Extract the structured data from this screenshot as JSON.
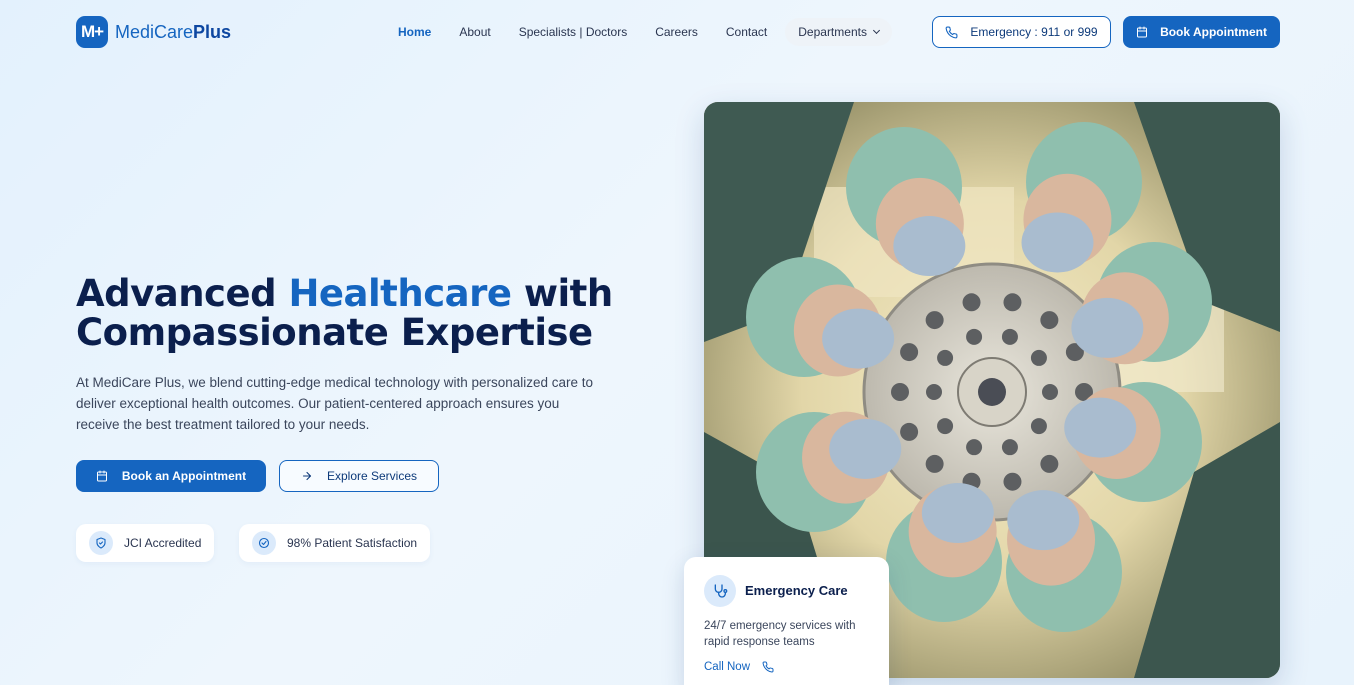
{
  "brand": {
    "logo_mark": "M+",
    "name_part1": "MediCare",
    "name_part2": "Plus"
  },
  "nav": {
    "items": [
      {
        "label": "Home"
      },
      {
        "label": "About"
      },
      {
        "label": "Specialists | Doctors"
      },
      {
        "label": "Careers"
      },
      {
        "label": "Contact"
      },
      {
        "label": "Departments"
      }
    ],
    "emergency_label": "Emergency : 911 or 999",
    "book_label": "Book Appointment"
  },
  "hero": {
    "title_part1": "Advanced ",
    "title_highlight": "Healthcare",
    "title_part2": " with",
    "title_line2": "Compassionate Expertise",
    "description": "At MediCare Plus, we blend cutting-edge medical technology with personalized care to deliver exceptional health outcomes. Our patient-centered approach ensures you receive the best treatment tailored to your needs.",
    "primary_cta": "Book an Appointment",
    "secondary_cta": "Explore Services",
    "badges": [
      {
        "label": "JCI Accredited",
        "icon": "shield-icon"
      },
      {
        "label": "98% Patient Satisfaction",
        "icon": "check-circle-icon"
      }
    ]
  },
  "emergency_card": {
    "title": "Emergency Care",
    "description": "24/7 emergency services with rapid response teams",
    "link": "Call Now"
  },
  "colors": {
    "primary": "#1565c0",
    "dark_navy": "#0b1f4d",
    "background": "#e8f3fc"
  }
}
